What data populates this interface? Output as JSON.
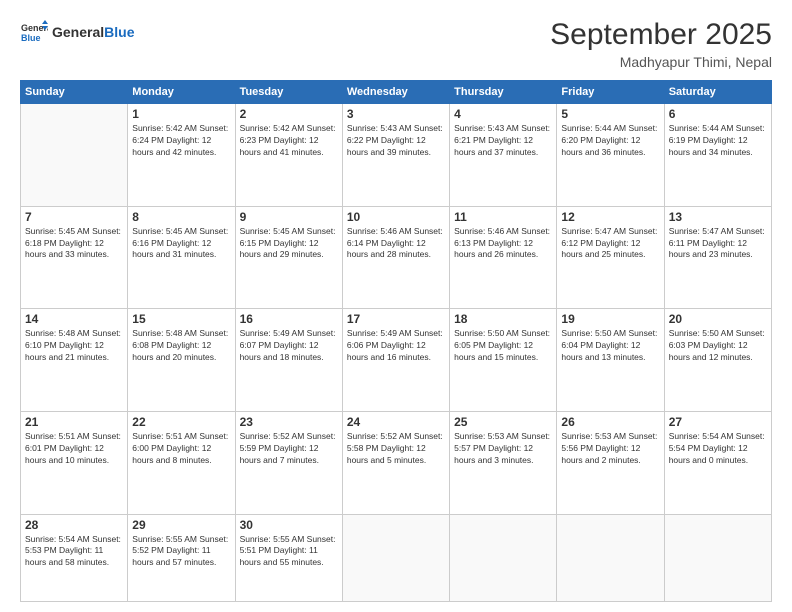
{
  "header": {
    "logo_general": "General",
    "logo_blue": "Blue",
    "title": "September 2025",
    "location": "Madhyapur Thimi, Nepal"
  },
  "days_of_week": [
    "Sunday",
    "Monday",
    "Tuesday",
    "Wednesday",
    "Thursday",
    "Friday",
    "Saturday"
  ],
  "weeks": [
    [
      {
        "day": "",
        "info": ""
      },
      {
        "day": "1",
        "info": "Sunrise: 5:42 AM\nSunset: 6:24 PM\nDaylight: 12 hours\nand 42 minutes."
      },
      {
        "day": "2",
        "info": "Sunrise: 5:42 AM\nSunset: 6:23 PM\nDaylight: 12 hours\nand 41 minutes."
      },
      {
        "day": "3",
        "info": "Sunrise: 5:43 AM\nSunset: 6:22 PM\nDaylight: 12 hours\nand 39 minutes."
      },
      {
        "day": "4",
        "info": "Sunrise: 5:43 AM\nSunset: 6:21 PM\nDaylight: 12 hours\nand 37 minutes."
      },
      {
        "day": "5",
        "info": "Sunrise: 5:44 AM\nSunset: 6:20 PM\nDaylight: 12 hours\nand 36 minutes."
      },
      {
        "day": "6",
        "info": "Sunrise: 5:44 AM\nSunset: 6:19 PM\nDaylight: 12 hours\nand 34 minutes."
      }
    ],
    [
      {
        "day": "7",
        "info": "Sunrise: 5:45 AM\nSunset: 6:18 PM\nDaylight: 12 hours\nand 33 minutes."
      },
      {
        "day": "8",
        "info": "Sunrise: 5:45 AM\nSunset: 6:16 PM\nDaylight: 12 hours\nand 31 minutes."
      },
      {
        "day": "9",
        "info": "Sunrise: 5:45 AM\nSunset: 6:15 PM\nDaylight: 12 hours\nand 29 minutes."
      },
      {
        "day": "10",
        "info": "Sunrise: 5:46 AM\nSunset: 6:14 PM\nDaylight: 12 hours\nand 28 minutes."
      },
      {
        "day": "11",
        "info": "Sunrise: 5:46 AM\nSunset: 6:13 PM\nDaylight: 12 hours\nand 26 minutes."
      },
      {
        "day": "12",
        "info": "Sunrise: 5:47 AM\nSunset: 6:12 PM\nDaylight: 12 hours\nand 25 minutes."
      },
      {
        "day": "13",
        "info": "Sunrise: 5:47 AM\nSunset: 6:11 PM\nDaylight: 12 hours\nand 23 minutes."
      }
    ],
    [
      {
        "day": "14",
        "info": "Sunrise: 5:48 AM\nSunset: 6:10 PM\nDaylight: 12 hours\nand 21 minutes."
      },
      {
        "day": "15",
        "info": "Sunrise: 5:48 AM\nSunset: 6:08 PM\nDaylight: 12 hours\nand 20 minutes."
      },
      {
        "day": "16",
        "info": "Sunrise: 5:49 AM\nSunset: 6:07 PM\nDaylight: 12 hours\nand 18 minutes."
      },
      {
        "day": "17",
        "info": "Sunrise: 5:49 AM\nSunset: 6:06 PM\nDaylight: 12 hours\nand 16 minutes."
      },
      {
        "day": "18",
        "info": "Sunrise: 5:50 AM\nSunset: 6:05 PM\nDaylight: 12 hours\nand 15 minutes."
      },
      {
        "day": "19",
        "info": "Sunrise: 5:50 AM\nSunset: 6:04 PM\nDaylight: 12 hours\nand 13 minutes."
      },
      {
        "day": "20",
        "info": "Sunrise: 5:50 AM\nSunset: 6:03 PM\nDaylight: 12 hours\nand 12 minutes."
      }
    ],
    [
      {
        "day": "21",
        "info": "Sunrise: 5:51 AM\nSunset: 6:01 PM\nDaylight: 12 hours\nand 10 minutes."
      },
      {
        "day": "22",
        "info": "Sunrise: 5:51 AM\nSunset: 6:00 PM\nDaylight: 12 hours\nand 8 minutes."
      },
      {
        "day": "23",
        "info": "Sunrise: 5:52 AM\nSunset: 5:59 PM\nDaylight: 12 hours\nand 7 minutes."
      },
      {
        "day": "24",
        "info": "Sunrise: 5:52 AM\nSunset: 5:58 PM\nDaylight: 12 hours\nand 5 minutes."
      },
      {
        "day": "25",
        "info": "Sunrise: 5:53 AM\nSunset: 5:57 PM\nDaylight: 12 hours\nand 3 minutes."
      },
      {
        "day": "26",
        "info": "Sunrise: 5:53 AM\nSunset: 5:56 PM\nDaylight: 12 hours\nand 2 minutes."
      },
      {
        "day": "27",
        "info": "Sunrise: 5:54 AM\nSunset: 5:54 PM\nDaylight: 12 hours\nand 0 minutes."
      }
    ],
    [
      {
        "day": "28",
        "info": "Sunrise: 5:54 AM\nSunset: 5:53 PM\nDaylight: 11 hours\nand 58 minutes."
      },
      {
        "day": "29",
        "info": "Sunrise: 5:55 AM\nSunset: 5:52 PM\nDaylight: 11 hours\nand 57 minutes."
      },
      {
        "day": "30",
        "info": "Sunrise: 5:55 AM\nSunset: 5:51 PM\nDaylight: 11 hours\nand 55 minutes."
      },
      {
        "day": "",
        "info": ""
      },
      {
        "day": "",
        "info": ""
      },
      {
        "day": "",
        "info": ""
      },
      {
        "day": "",
        "info": ""
      }
    ]
  ]
}
